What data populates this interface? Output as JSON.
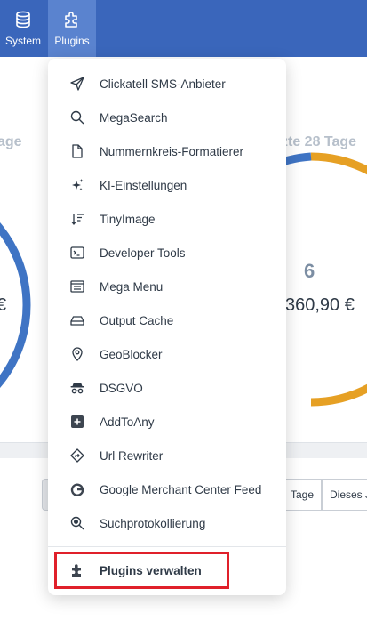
{
  "nav": {
    "system_label": "System",
    "plugins_label": "Plugins",
    "bar_color": "#3a66bb",
    "active_color": "#5a83cf"
  },
  "dashboard": {
    "left_title_fragment": "age",
    "right_title_fragment": "zte 28 Tage",
    "left_value_fragment": "€",
    "count": "6",
    "amount": "360,90 €",
    "period_buttons": [
      "Tage",
      "Dieses J"
    ],
    "donut_colors": {
      "blue": "#3f74c4",
      "orange": "#e6a024"
    }
  },
  "plugins_menu": {
    "items": [
      {
        "label": "Clickatell SMS-Anbieter",
        "icon": "paper-plane-icon"
      },
      {
        "label": "MegaSearch",
        "icon": "search-icon"
      },
      {
        "label": "Nummernkreis-Formatierer",
        "icon": "document-icon"
      },
      {
        "label": "KI-Einstellungen",
        "icon": "sparkles-icon"
      },
      {
        "label": "TinyImage",
        "icon": "sort-down-icon"
      },
      {
        "label": "Developer Tools",
        "icon": "terminal-icon"
      },
      {
        "label": "Mega Menu",
        "icon": "menu-stack-icon"
      },
      {
        "label": "Output Cache",
        "icon": "hard-drive-icon"
      },
      {
        "label": "GeoBlocker",
        "icon": "map-pin-icon"
      },
      {
        "label": "DSGVO",
        "icon": "spy-icon"
      },
      {
        "label": "AddToAny",
        "icon": "plus-square-icon"
      },
      {
        "label": "Url Rewriter",
        "icon": "route-sign-icon"
      },
      {
        "label": "Google Merchant Center Feed",
        "icon": "google-icon"
      },
      {
        "label": "Suchprotokollierung",
        "icon": "search-log-icon"
      }
    ],
    "manage_label": "Plugins verwalten",
    "manage_icon": "puzzle-icon",
    "highlight_color": "#e0202a"
  }
}
